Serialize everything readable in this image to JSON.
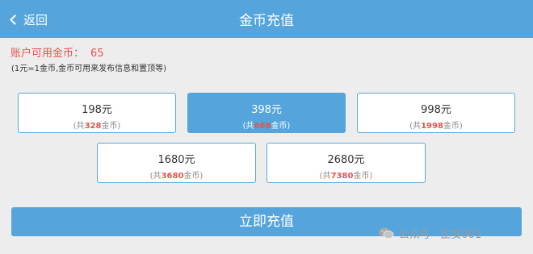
{
  "header": {
    "back_label": "返回",
    "title": "金币充值"
  },
  "account": {
    "balance_label": "账户可用金币：",
    "balance_value": "65",
    "note": "(1元=1金币,金币可用来发布信息和置顶等)"
  },
  "options": [
    {
      "price": "198元",
      "coins_prefix": "(共",
      "coins": "328",
      "coins_suffix": "金币)",
      "selected": false
    },
    {
      "price": "398元",
      "coins_prefix": "(共",
      "coins": "668",
      "coins_suffix": "金币)",
      "selected": true
    },
    {
      "price": "998元",
      "coins_prefix": "(共",
      "coins": "1998",
      "coins_suffix": "金币)",
      "selected": false
    },
    {
      "price": "1680元",
      "coins_prefix": "(共",
      "coins": "3680",
      "coins_suffix": "金币)",
      "selected": false
    },
    {
      "price": "2680元",
      "coins_prefix": "(共",
      "coins": "7380",
      "coins_suffix": "金币)",
      "selected": false
    }
  ],
  "submit_label": "立即充值",
  "watermark": {
    "icon": "wechat-icon",
    "text": "公众号 · 正安001"
  },
  "colors": {
    "primary": "#55a5dc",
    "accent_red": "#e5534b",
    "background": "#ededed"
  }
}
